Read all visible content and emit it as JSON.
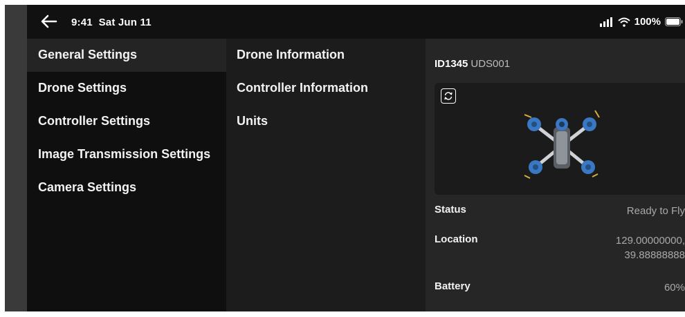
{
  "status_bar": {
    "time": "9:41",
    "date": "Sat Jun 11",
    "battery": "100%",
    "icons": [
      "back-arrow-icon",
      "signal-icon",
      "wifi-icon",
      "battery-icon"
    ]
  },
  "settings_menu": {
    "items": [
      {
        "label": "General Settings",
        "selected": true
      },
      {
        "label": "Drone Settings",
        "selected": false
      },
      {
        "label": "Controller Settings",
        "selected": false
      },
      {
        "label": "Image Transmission Settings",
        "selected": false
      },
      {
        "label": "Camera Settings",
        "selected": false
      }
    ]
  },
  "general_submenu": {
    "items": [
      {
        "label": "Drone Information"
      },
      {
        "label": "Controller Information"
      },
      {
        "label": "Units"
      }
    ]
  },
  "drone_info": {
    "id": "ID1345",
    "model": "UDS001",
    "refresh_icon": "refresh-icon",
    "status_label": "Status",
    "status_value": "Ready to Fly",
    "location_label": "Location",
    "location_line1": "129.00000000,",
    "location_line2": "39.88888888",
    "battery_label": "Battery",
    "battery_value": "60%"
  },
  "colors": {
    "background": "#1b1b1b",
    "panel_left": "#0f0f0f",
    "panel_middle": "#1c1c1c",
    "panel_right": "#262626",
    "selected": "#242424",
    "drone_accent": "#3a78c4"
  }
}
